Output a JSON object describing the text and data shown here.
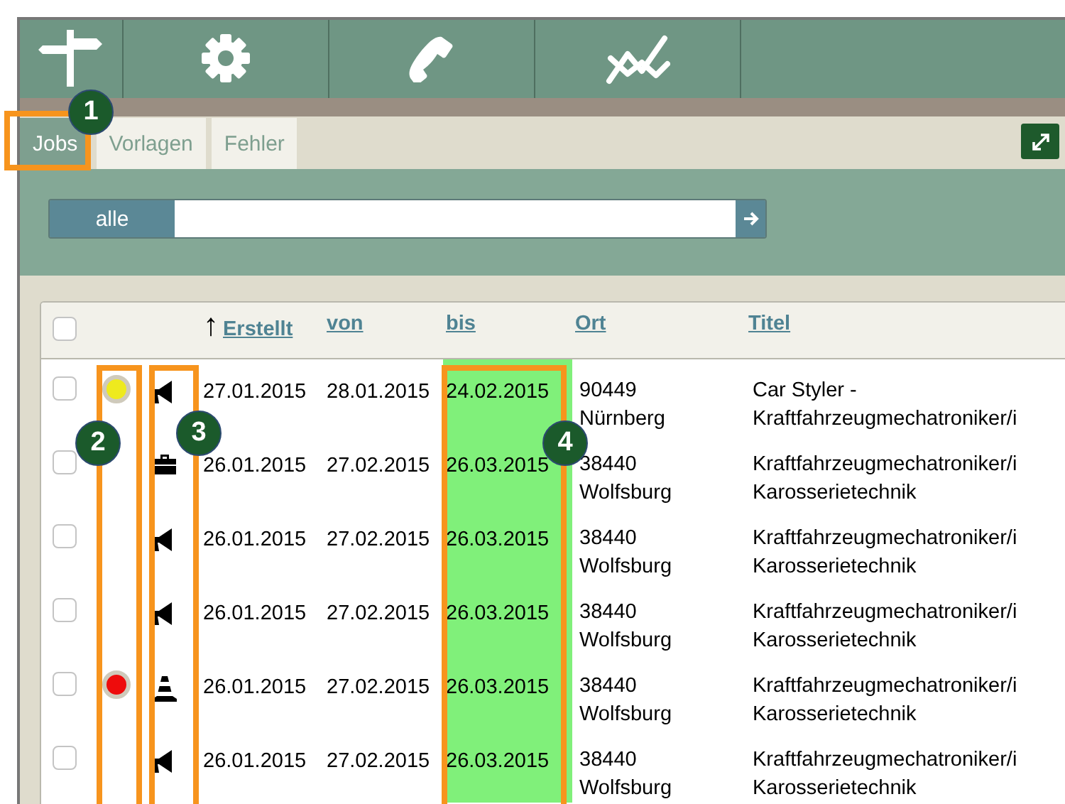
{
  "tabs": [
    {
      "label": "Jobs",
      "selected": true
    },
    {
      "label": "Vorlagen",
      "selected": false
    },
    {
      "label": "Fehler",
      "selected": false
    }
  ],
  "filter": {
    "label": "alle"
  },
  "table": {
    "header_checked": false,
    "columns": [
      {
        "label": "Erstellt",
        "sort_indicator": "↑",
        "highlighted": false
      },
      {
        "label": "von",
        "highlighted": false
      },
      {
        "label": "bis",
        "highlighted": true
      },
      {
        "label": "Ort",
        "highlighted": false
      },
      {
        "label": "Titel",
        "highlighted": false
      }
    ],
    "rows": [
      {
        "checked": false,
        "color": "#eeea1e",
        "kind": "megaphone",
        "cells": [
          "27.01.2015",
          "28.01.2015",
          "24.02.2015",
          [
            "90449",
            "Nürnberg"
          ],
          [
            "Car Styler -",
            "Kraftfahrzeugmechatroniker/i"
          ]
        ]
      },
      {
        "checked": false,
        "kind": "briefcase",
        "cells": [
          "26.01.2015",
          "27.02.2015",
          "26.03.2015",
          [
            "38440",
            "Wolfsburg"
          ],
          [
            "Kraftfahrzeugmechatroniker/i",
            "Karosserietechnik"
          ]
        ]
      },
      {
        "checked": false,
        "kind": "megaphone",
        "cells": [
          "26.01.2015",
          "27.02.2015",
          "26.03.2015",
          [
            "38440",
            "Wolfsburg"
          ],
          [
            "Kraftfahrzeugmechatroniker/i",
            "Karosserietechnik"
          ]
        ]
      },
      {
        "checked": false,
        "kind": "megaphone",
        "cells": [
          "26.01.2015",
          "27.02.2015",
          "26.03.2015",
          [
            "38440",
            "Wolfsburg"
          ],
          [
            "Kraftfahrzeugmechatroniker/i",
            "Karosserietechnik"
          ]
        ]
      },
      {
        "checked": false,
        "color": "#ee0c0c",
        "kind": "cone",
        "cells": [
          "26.01.2015",
          "27.02.2015",
          "26.03.2015",
          [
            "38440",
            "Wolfsburg"
          ],
          [
            "Kraftfahrzeugmechatroniker/i",
            "Karosserietechnik"
          ]
        ]
      },
      {
        "checked": false,
        "kind": "megaphone",
        "cells": [
          "26.01.2015",
          "27.02.2015",
          "26.03.2015",
          [
            "38440",
            "Wolfsburg"
          ],
          [
            "Kraftfahrzeugmechatroniker/i",
            "Karosserietechnik"
          ]
        ]
      }
    ]
  },
  "annotations": [
    {
      "label": "1"
    },
    {
      "label": "2"
    },
    {
      "label": "3"
    },
    {
      "label": "4"
    }
  ]
}
